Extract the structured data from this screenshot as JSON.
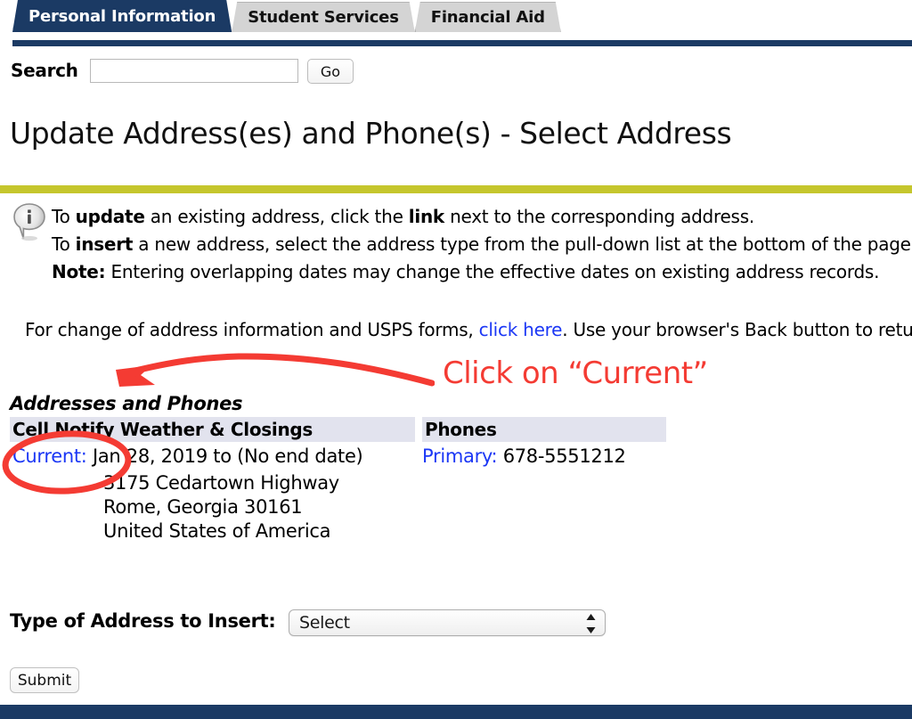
{
  "nav": {
    "tabs": [
      {
        "label": "Personal Information",
        "active": true
      },
      {
        "label": "Student Services",
        "active": false
      },
      {
        "label": "Financial Aid",
        "active": false
      }
    ]
  },
  "search": {
    "label": "Search",
    "value": "",
    "placeholder": "",
    "go_label": "Go"
  },
  "header": {
    "title": "Update Address(es) and Phone(s) - Select Address"
  },
  "info": {
    "icon": "info-balloon-icon",
    "line1_pre": "To ",
    "line1_b1": "update",
    "line1_mid": " an existing address, click the ",
    "line1_b2": "link",
    "line1_post": " next to the corresponding address.",
    "line2_pre": "To ",
    "line2_b1": "insert",
    "line2_post": " a new address, select the address type from the pull-down list at the bottom of the page.",
    "line3_b1": "Note:",
    "line3_post": " Entering overlapping dates may change the effective dates on existing address records."
  },
  "usps": {
    "pre": "For change of address information and USPS forms, ",
    "link": "click here",
    "post": ". Use your browser's Back button to return to this page."
  },
  "annotation": {
    "text": "Click on “Current”",
    "color": "#f43b33",
    "arrow": "curved-left-arrow",
    "circle": "ellipse-highlight"
  },
  "addresses": {
    "section_title": "Addresses and Phones",
    "columns": [
      "Cell Notify Weather & Closings",
      "Phones"
    ],
    "header_bg": "#e2e3ee",
    "rows": [
      {
        "link_label": "Current:",
        "date_range": "Jan 28, 2019 to (No end date)",
        "phone_label": "Primary:",
        "phone_number": "678-5551212",
        "address_lines": [
          "3175 Cedartown Highway",
          "Rome, Georgia    30161",
          "United States of America"
        ]
      }
    ]
  },
  "form": {
    "insert_label": "Type of Address to Insert:",
    "select_value": "Select",
    "submit_label": "Submit"
  },
  "colors": {
    "nav_navy": "#1b3a64",
    "divider_olive": "#c5c62d",
    "link_blue": "#1b37f5",
    "annotation_red": "#f43b33"
  }
}
